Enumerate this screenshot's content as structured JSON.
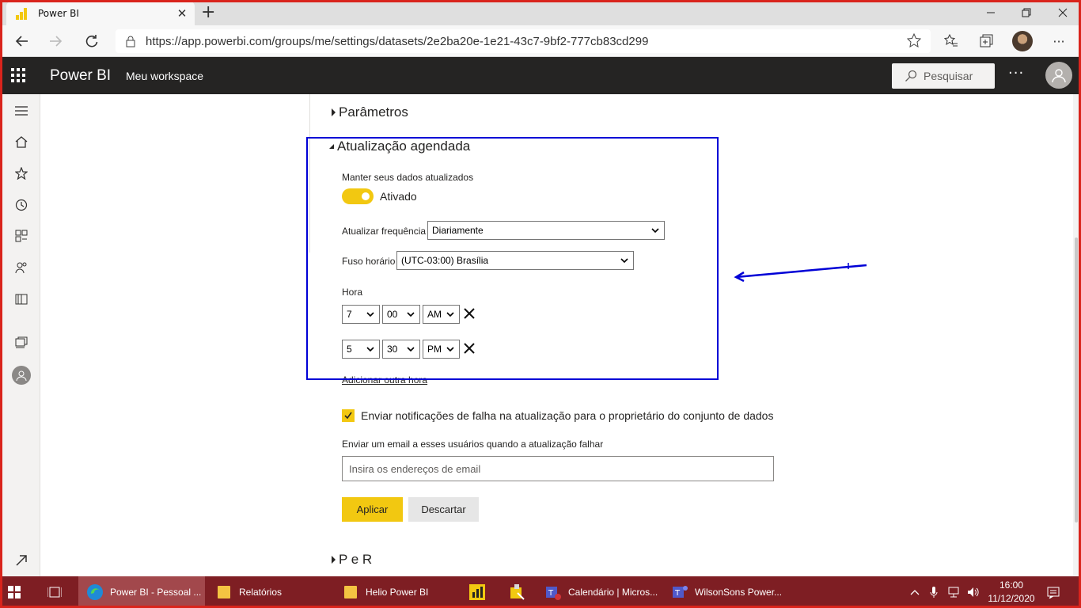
{
  "browser": {
    "tab_title": "Power BI",
    "url": "https://app.powerbi.com/groups/me/settings/datasets/2e2ba20e-1e21-43c7-9bf2-777cb83cd299"
  },
  "header": {
    "app_name": "Power BI",
    "workspace": "Meu workspace",
    "search_placeholder": "Pesquisar"
  },
  "settings": {
    "section_parametros": "Parâmetros",
    "section_atualizacao": "Atualização agendada",
    "keep_updated_label": "Manter seus dados atualizados",
    "toggle_state": "Ativado",
    "toggle_on": true,
    "frequency_label": "Atualizar frequência",
    "frequency_value": "Diariamente",
    "timezone_label": "Fuso horário",
    "timezone_value": "(UTC-03:00) Brasília",
    "hora_label": "Hora",
    "times": [
      {
        "hour": "7",
        "minute": "00",
        "period": "AM"
      },
      {
        "hour": "5",
        "minute": "30",
        "period": "PM"
      }
    ],
    "add_time_link": "Adicionar outra hora",
    "notify_checkbox_label": "Enviar notificações de falha na atualização para o proprietário do conjunto de dados",
    "notify_checked": true,
    "email_users_label": "Enviar um email a esses usuários quando a atualização falhar",
    "email_placeholder": "Insira os endereços de email",
    "apply_button": "Aplicar",
    "discard_button": "Descartar",
    "section_per": "P e R"
  },
  "taskbar": {
    "items": [
      {
        "label": "Power BI - Pessoal ..."
      },
      {
        "label": "Relatórios"
      },
      {
        "label": "Helio Power BI"
      },
      {
        "label": "Calendário | Micros..."
      },
      {
        "label": "WilsonSons Power..."
      }
    ],
    "time": "16:00",
    "date": "11/12/2020"
  },
  "colors": {
    "accent": "#f2c811",
    "header_bg": "#252423",
    "taskbar_bg": "#7e1e23",
    "annotation": "#0000d6",
    "frame": "#d9241c"
  }
}
